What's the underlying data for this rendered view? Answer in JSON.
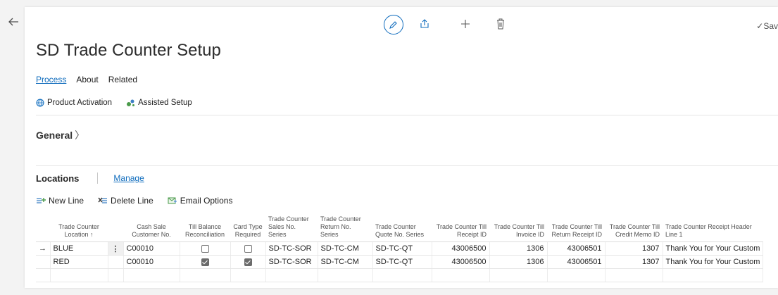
{
  "header": {
    "title": "SD Trade Counter Setup",
    "saved_label": "✓Sav"
  },
  "tabs": [
    {
      "label": "Process"
    },
    {
      "label": "About"
    },
    {
      "label": "Related"
    }
  ],
  "actions": [
    {
      "label": "Product Activation",
      "icon": "globe-icon"
    },
    {
      "label": "Assisted Setup",
      "icon": "wand-icon"
    }
  ],
  "general": {
    "label": "General",
    "chevron": "〉"
  },
  "locations": {
    "title": "Locations",
    "manage_label": "Manage",
    "actions": [
      {
        "label": "New Line",
        "icon": "new-line-icon"
      },
      {
        "label": "Delete Line",
        "icon": "delete-line-icon"
      },
      {
        "label": "Email Options",
        "icon": "email-options-icon"
      }
    ],
    "columns": [
      "",
      "Trade Counter Location ↑",
      "",
      "Cash Sale Customer No.",
      "Till Balance Reconciliation",
      "Card Type Required",
      "Trade Counter Sales No. Series",
      "Trade Counter Return No. Series",
      "Trade Counter Quote No. Series",
      "Trade Counter Till Receipt ID",
      "Trade Counter Till Invoice ID",
      "Trade Counter Till Return Receipt ID",
      "Trade Counter Till Credit Memo ID",
      "Trade Counter Receipt Header Line 1"
    ],
    "rows": [
      {
        "marker": "→",
        "location": "BLUE",
        "menu": "⋮",
        "customer": "C00010",
        "till_balance": false,
        "card_type": false,
        "sales_series": "SD-TC-SOR",
        "return_series": "SD-TC-CM",
        "quote_series": "SD-TC-QT",
        "receipt_id": "43006500",
        "invoice_id": "1306",
        "return_receipt_id": "43006501",
        "credit_memo_id": "1307",
        "header_line": "Thank You for Your Custom"
      },
      {
        "marker": "",
        "location": "RED",
        "menu": "",
        "customer": "C00010",
        "till_balance": true,
        "card_type": true,
        "sales_series": "SD-TC-SOR",
        "return_series": "SD-TC-CM",
        "quote_series": "SD-TC-QT",
        "receipt_id": "43006500",
        "invoice_id": "1306",
        "return_receipt_id": "43006501",
        "credit_memo_id": "1307",
        "header_line": "Thank You for Your Custom"
      }
    ]
  },
  "colors": {
    "accent": "#0f6cbd",
    "background": "#f3f3f3",
    "card": "#ffffff"
  }
}
